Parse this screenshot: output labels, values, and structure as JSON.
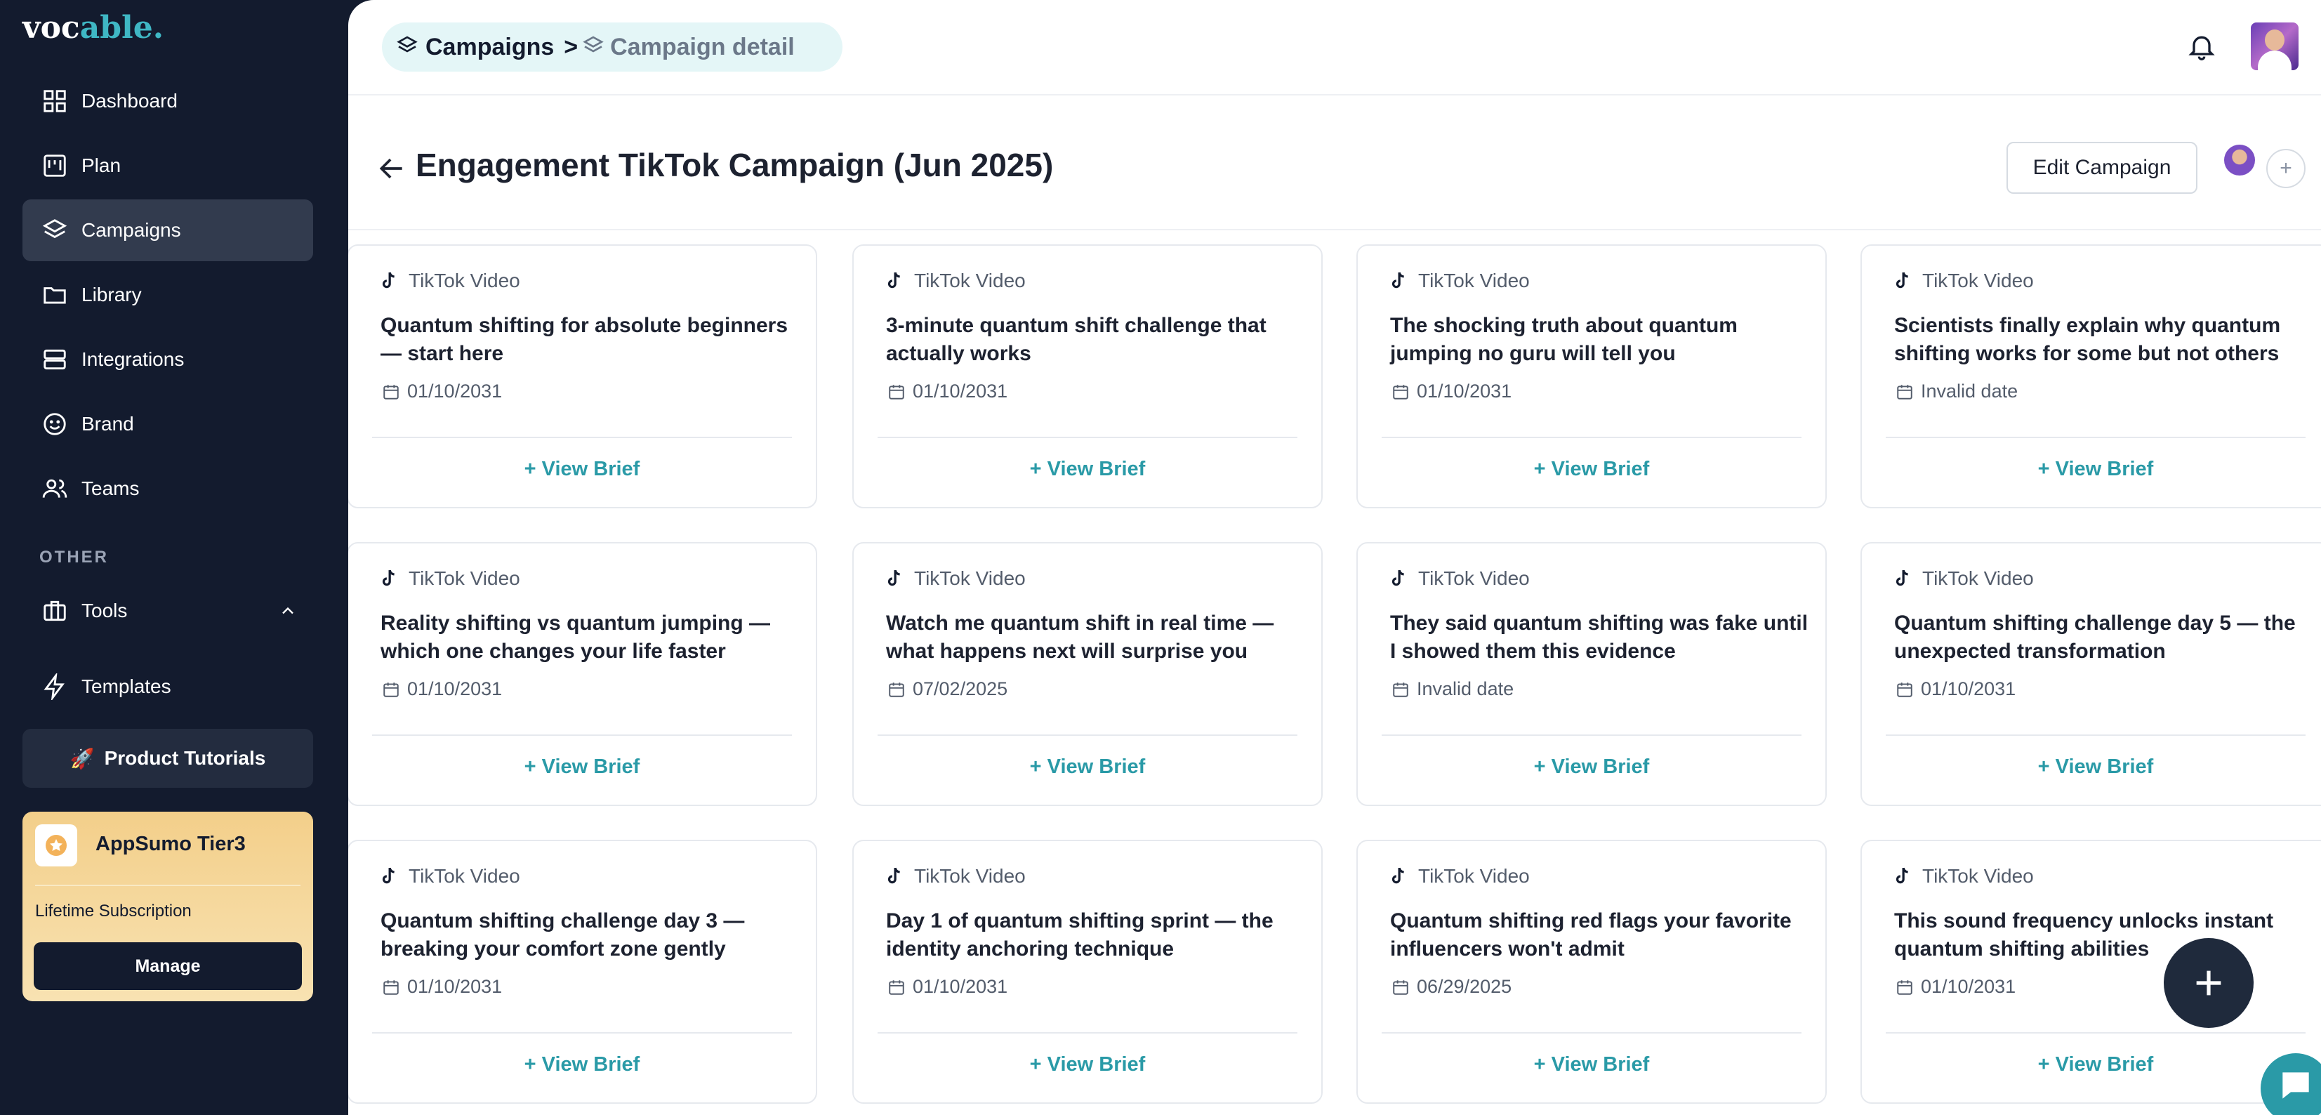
{
  "brand": {
    "logo_main": "voc",
    "logo_accent": "able",
    "logo_dot": "."
  },
  "sidebar": {
    "nav": [
      {
        "label": "Dashboard",
        "icon": "dashboard-icon"
      },
      {
        "label": "Plan",
        "icon": "plan-icon"
      },
      {
        "label": "Campaigns",
        "icon": "layers-icon",
        "active": true
      },
      {
        "label": "Library",
        "icon": "folder-icon"
      },
      {
        "label": "Integrations",
        "icon": "server-icon"
      },
      {
        "label": "Brand",
        "icon": "smile-icon"
      },
      {
        "label": "Teams",
        "icon": "users-icon"
      }
    ],
    "section_other": "OTHER",
    "tools_label": "Tools",
    "templates_label": "Templates",
    "tutorials_label": "Product Tutorials",
    "plan": {
      "name": "AppSumo Tier3",
      "subtitle": "Lifetime Subscription",
      "manage_label": "Manage"
    }
  },
  "breadcrumb": {
    "root": "Campaigns",
    "separator": ">",
    "current": "Campaign detail"
  },
  "page": {
    "title": "Engagement TikTok Campaign (Jun 2025)",
    "edit_label": "Edit Campaign",
    "add_member_label": "+"
  },
  "cards": [
    {
      "type": "TikTok Video",
      "title": "Quantum shifting for absolute beginners — start here",
      "date": "01/10/2031",
      "brief": "+ View Brief"
    },
    {
      "type": "TikTok Video",
      "title": "3-minute quantum shift challenge that actually works",
      "date": "01/10/2031",
      "brief": "+ View Brief"
    },
    {
      "type": "TikTok Video",
      "title": "The shocking truth about quantum jumping no guru will tell you",
      "date": "01/10/2031",
      "brief": "+ View Brief"
    },
    {
      "type": "TikTok Video",
      "title": "Scientists finally explain why quantum shifting works for some but not others",
      "date": "Invalid date",
      "brief": "+ View Brief"
    },
    {
      "type": "TikTok Video",
      "title": "Reality shifting vs quantum jumping — which one changes your life faster",
      "date": "01/10/2031",
      "brief": "+ View Brief"
    },
    {
      "type": "TikTok Video",
      "title": "Watch me quantum shift in real time — what happens next will surprise you",
      "date": "07/02/2025",
      "brief": "+ View Brief"
    },
    {
      "type": "TikTok Video",
      "title": "They said quantum shifting was fake until I showed them this evidence",
      "date": "Invalid date",
      "brief": "+ View Brief"
    },
    {
      "type": "TikTok Video",
      "title": "Quantum shifting challenge day 5 — the unexpected transformation",
      "date": "01/10/2031",
      "brief": "+ View Brief"
    },
    {
      "type": "TikTok Video",
      "title": "Quantum shifting challenge day 3 — breaking your comfort zone gently",
      "date": "01/10/2031",
      "brief": "+ View Brief"
    },
    {
      "type": "TikTok Video",
      "title": "Day 1 of quantum shifting sprint — the identity anchoring technique",
      "date": "01/10/2031",
      "brief": "+ View Brief"
    },
    {
      "type": "TikTok Video",
      "title": "Quantum shifting red flags your favorite influencers won't admit",
      "date": "06/29/2025",
      "brief": "+ View Brief"
    },
    {
      "type": "TikTok Video",
      "title": "This sound frequency unlocks instant quantum shifting abilities",
      "date": "01/10/2031",
      "brief": "+ View Brief"
    }
  ],
  "colors": {
    "sidebar_bg": "#131b2e",
    "accent": "#2a9aa7",
    "active_nav": "#323b4e",
    "plan_gold": "#f3cf8a"
  }
}
